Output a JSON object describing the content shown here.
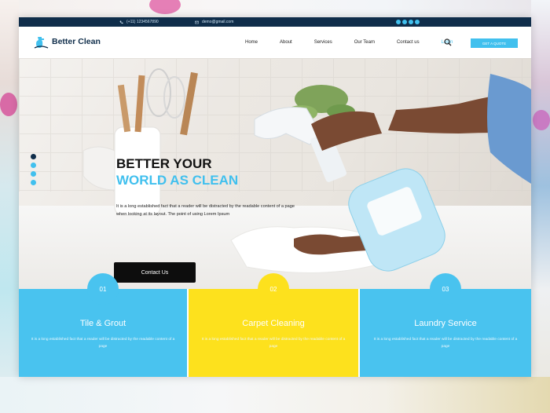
{
  "topbar": {
    "phone": "(+11) 1234567890",
    "email": "demo@gmail.com",
    "social_icons": [
      "facebook-icon",
      "twitter-icon",
      "instagram-icon",
      "linkedin-icon"
    ]
  },
  "brand": {
    "name": "Better Clean",
    "accent": "#41c0ee",
    "dark": "#0f2d4a",
    "yellow": "#fde11d"
  },
  "nav": {
    "items": [
      {
        "label": "Home"
      },
      {
        "label": "About"
      },
      {
        "label": "Services"
      },
      {
        "label": "Our Team"
      },
      {
        "label": "Contact us"
      },
      {
        "label": "Login"
      }
    ],
    "cta": "GET A QUOTE"
  },
  "hero": {
    "title_line1": "BETTER YOUR",
    "title_line2": "WORLD AS CLEAN",
    "text": "It is a long established fact that a reader will be distracted by the readable content of a page when looking at its layout. The point of using Lorem Ipsum",
    "button": "Contact Us",
    "slider_current": "02"
  },
  "services": [
    {
      "num": "01",
      "title": "Tile & Grout",
      "desc": "It is a long established fact that a reader will be distracted by the readable content of a page"
    },
    {
      "num": "02",
      "title": "Carpet Cleaning",
      "desc": "It is a long established fact that a reader will be distracted by the readable content of a page"
    },
    {
      "num": "03",
      "title": "Laundry Service",
      "desc": "It is a long established fact that a reader will be distracted by the readable content of a page"
    }
  ]
}
